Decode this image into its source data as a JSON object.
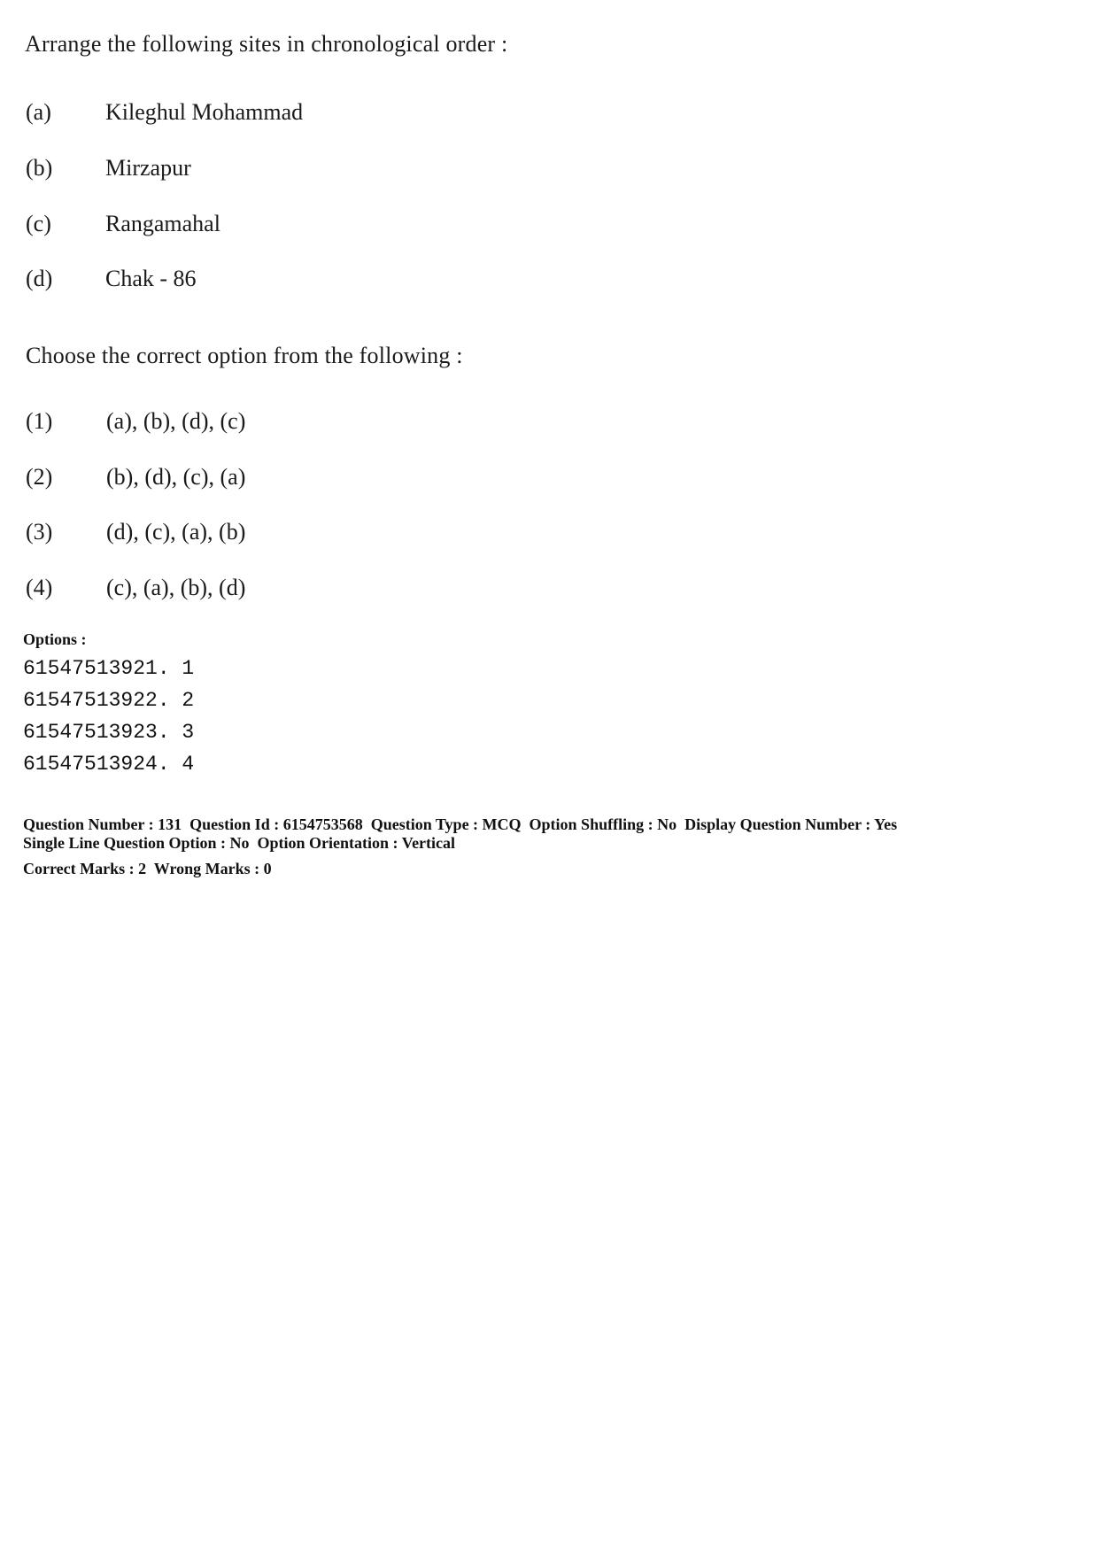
{
  "question": {
    "prompt": "Arrange the following sites in chronological order :",
    "items": [
      {
        "label": "(a)",
        "text": "Kileghul Mohammad"
      },
      {
        "label": "(b)",
        "text": "Mirzapur"
      },
      {
        "label": "(c)",
        "text": "Rangamahal"
      },
      {
        "label": "(d)",
        "text": "Chak - 86"
      }
    ],
    "instruction": "Choose the correct option from the following :",
    "choices": [
      {
        "label": "(1)",
        "text": "(a), (b), (d), (c)"
      },
      {
        "label": "(2)",
        "text": "(b), (d), (c), (a)"
      },
      {
        "label": "(3)",
        "text": "(d), (c), (a), (b)"
      },
      {
        "label": "(4)",
        "text": "(c), (a), (b), (d)"
      }
    ]
  },
  "options": {
    "heading": "Options :",
    "list": [
      "61547513921. 1",
      "61547513922. 2",
      "61547513923. 3",
      "61547513924. 4"
    ]
  },
  "metadata": {
    "line1": "Question Number : 131  Question Id : 6154753568  Question Type : MCQ  Option Shuffling : No  Display Question Number : Yes",
    "line2": "Single Line Question Option : No  Option Orientation : Vertical",
    "line3": "Correct Marks : 2  Wrong Marks : 0"
  }
}
